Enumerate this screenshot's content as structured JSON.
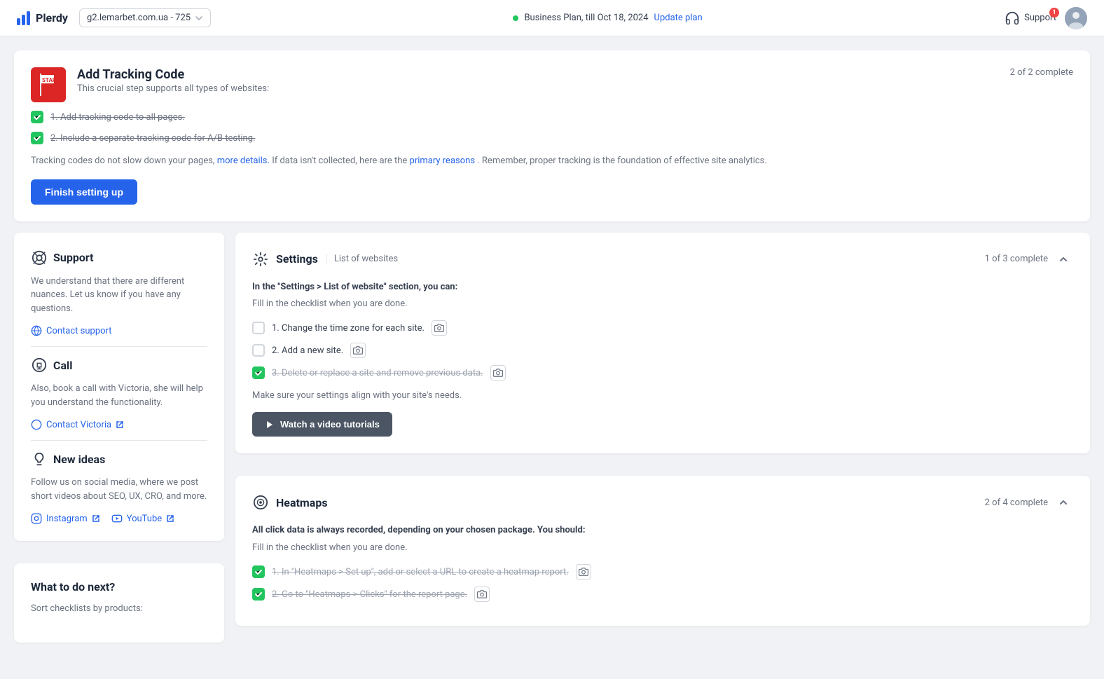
{
  "header": {
    "logo_text": "Plerdy",
    "site_label": "g2.lemarbet.com.ua - 725",
    "plan_text": "Business Plan, till Oct 18, 2024",
    "update_label": "Update plan",
    "support_label": "Support",
    "notif_count": "1"
  },
  "tracking_card": {
    "title": "Add Tracking Code",
    "subtitle": "This crucial step supports all types of websites:",
    "complete_label": "2 of 2 complete",
    "items": [
      {
        "text": "1. Add tracking code to all pages.",
        "done": true
      },
      {
        "text": "2. Include a separate tracking code for A/B testing.",
        "done": true
      }
    ],
    "info_text_1": "Tracking codes do not slow down your pages,",
    "info_link_1": "more details.",
    "info_text_2": "If data isn't collected, here are the",
    "info_link_2": "primary reasons",
    "info_text_3": ". Remember, proper tracking is the foundation of effective site analytics.",
    "finish_btn": "Finish setting up"
  },
  "support_card": {
    "title": "Support",
    "desc": "We understand that there are different nuances. Let us know if you have any questions.",
    "contact_label": "Contact support"
  },
  "call_card": {
    "title": "Call",
    "desc": "Also, book a call with Victoria, she will help you understand the functionality.",
    "contact_label": "Contact Victoria"
  },
  "new_ideas_card": {
    "title": "New ideas",
    "desc": "Follow us on social media, where we post short videos about SEO, UX, CRO, and more.",
    "instagram_label": "Instagram",
    "youtube_label": "YouTube"
  },
  "what_next_card": {
    "title": "What to do next?",
    "desc": "Sort checklists by products:"
  },
  "settings_card": {
    "title": "Settings",
    "breadcrumb": "List of websites",
    "complete_label": "1 of 3 complete",
    "section_title": "In the \"Settings > List of website\" section, you can:",
    "sub_text": "Fill in the checklist when you are done.",
    "items": [
      {
        "text": "1. Change the time zone for each site.",
        "done": false,
        "strike": false
      },
      {
        "text": "2. Add a new site.",
        "done": false,
        "strike": false
      },
      {
        "text": "3. Delete or replace a site and remove previous data.",
        "done": true,
        "strike": true
      }
    ],
    "make_sure_text": "Make sure your settings align with your site's needs.",
    "watch_btn": "Watch a video tutorials"
  },
  "heatmaps_card": {
    "title": "Heatmaps",
    "complete_label": "2 of 4 complete",
    "section_title": "All click data is always recorded, depending on your chosen package. You should:",
    "sub_text": "Fill in the checklist when you are done.",
    "items": [
      {
        "text": "1. In \"Heatmaps > Set up\", add or select a URL to create a heatmap report.",
        "done": true,
        "strike": true
      },
      {
        "text": "2. Go to \"Heatmaps > Clicks\" for the report page.",
        "done": true,
        "strike": true
      }
    ]
  }
}
